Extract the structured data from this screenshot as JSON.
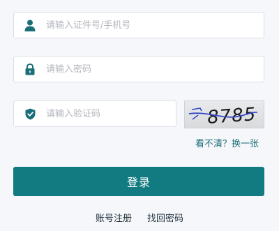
{
  "form": {
    "username": {
      "placeholder": "请输入证件号/手机号",
      "value": "",
      "icon": "user-icon"
    },
    "password": {
      "placeholder": "请输入密码",
      "value": "",
      "icon": "lock-icon"
    },
    "captcha": {
      "placeholder": "请输入验证码",
      "value": "",
      "icon": "shield-check-icon",
      "image_text": "8785",
      "refresh_label": "看不清？换一张"
    },
    "submit_label": "登录"
  },
  "footer": {
    "register_label": "账号注册",
    "forgot_label": "找回密码"
  },
  "colors": {
    "accent": "#127b81",
    "link": "#1b6e78",
    "captcha_ink": "#3a4bc8"
  }
}
